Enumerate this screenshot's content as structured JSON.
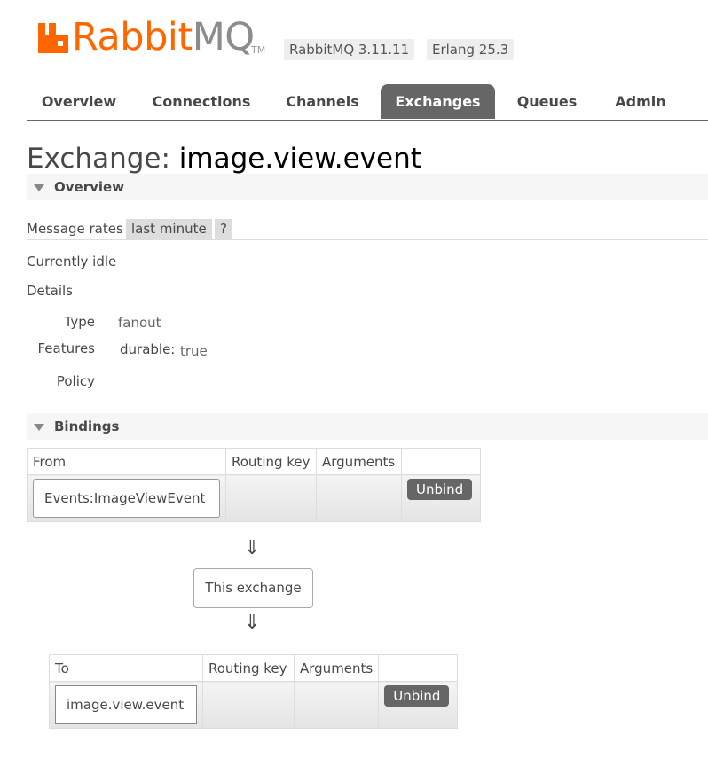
{
  "header": {
    "logo_word_rabbit": "Rabbit",
    "logo_word_mq": "MQ",
    "logo_tm": "TM",
    "version_badge": "RabbitMQ 3.11.11",
    "erlang_badge": "Erlang 25.3",
    "brand_color": "#ff6600"
  },
  "tabs": [
    {
      "label": "Overview"
    },
    {
      "label": "Connections"
    },
    {
      "label": "Channels"
    },
    {
      "label": "Exchanges",
      "active": true
    },
    {
      "label": "Queues"
    },
    {
      "label": "Admin"
    }
  ],
  "page": {
    "title_prefix": "Exchange:",
    "title_name": "image.view.event"
  },
  "overview": {
    "section_label": "Overview",
    "message_rates_label": "Message rates",
    "rate_period": "last minute",
    "help": "?",
    "status": "Currently idle",
    "details_label": "Details",
    "details": {
      "type_label": "Type",
      "type_value": "fanout",
      "features_label": "Features",
      "feature_key": "durable:",
      "feature_value": "true",
      "policy_label": "Policy",
      "policy_value": ""
    }
  },
  "bindings": {
    "section_label": "Bindings",
    "from_table": {
      "headers": [
        "From",
        "Routing key",
        "Arguments",
        ""
      ],
      "rows": [
        {
          "source": "Events:ImageViewEvent",
          "routing_key": "",
          "arguments": "",
          "action": "Unbind"
        }
      ]
    },
    "down_arrow": "⇓",
    "this_exchange": "This exchange",
    "to_table": {
      "headers": [
        "To",
        "Routing key",
        "Arguments",
        ""
      ],
      "rows": [
        {
          "destination": "image.view.event",
          "routing_key": "",
          "arguments": "",
          "action": "Unbind"
        }
      ]
    }
  }
}
